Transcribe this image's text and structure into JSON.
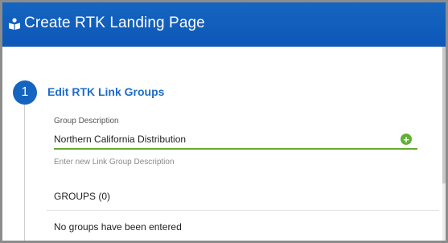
{
  "header": {
    "title": "Create RTK Landing Page",
    "icon": "book-user-icon",
    "background": "#1565c0"
  },
  "step": {
    "number": "1",
    "title": "Edit RTK Link Groups",
    "accent": "#1565c0"
  },
  "group_description": {
    "label": "Group Description",
    "value": "Northern California Distribution",
    "hint": "Enter new Link Group Description",
    "underline_color": "#66a82f",
    "add_icon": "plus-circle-icon"
  },
  "groups": {
    "heading": "GROUPS (0)",
    "empty_message": "No groups have been entered"
  }
}
